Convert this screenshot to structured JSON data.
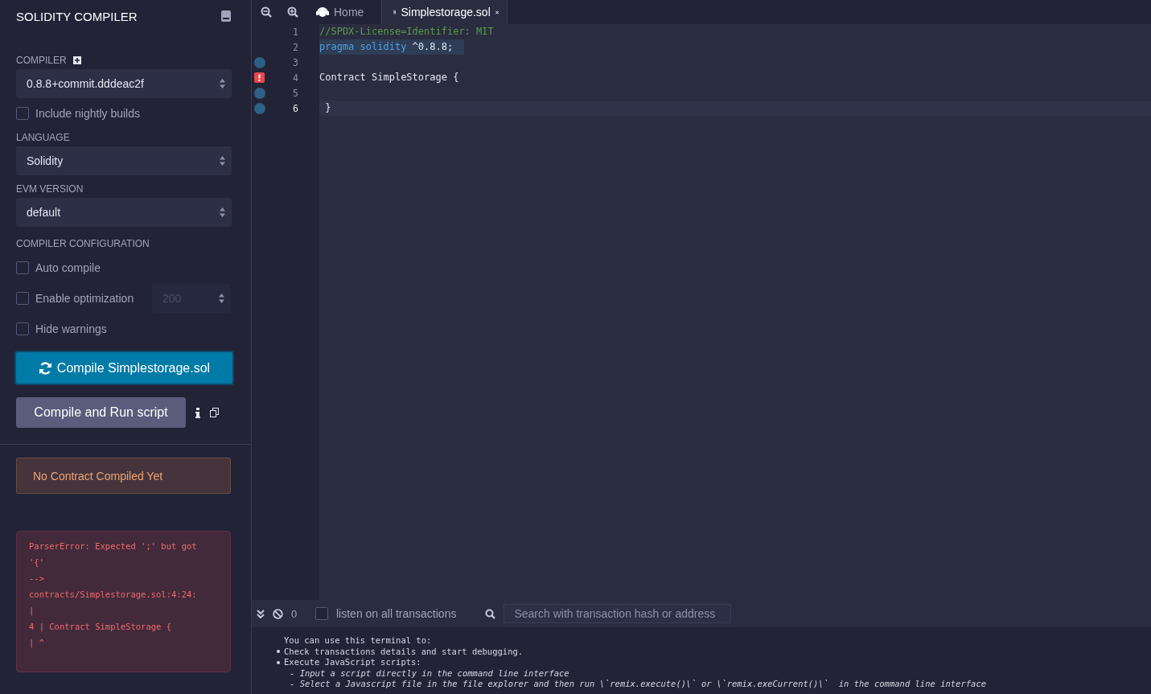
{
  "sidebar": {
    "title": "SOLIDITY COMPILER",
    "compiler": {
      "label": "COMPILER",
      "value": "0.8.8+commit.dddeac2f"
    },
    "nightly": {
      "label": "Include nightly builds",
      "checked": false
    },
    "language": {
      "label": "LANGUAGE",
      "value": "Solidity"
    },
    "evm": {
      "label": "EVM VERSION",
      "value": "default"
    },
    "config": {
      "label": "COMPILER CONFIGURATION"
    },
    "options": [
      {
        "label": "Auto compile",
        "checked": false
      },
      {
        "label": "Enable optimization",
        "checked": false,
        "runs": "200"
      },
      {
        "label": "Hide warnings",
        "checked": false
      }
    ],
    "compile_button": "Compile Simplestorage.sol",
    "run_button": "Compile and Run script",
    "status": "No Contract Compiled Yet",
    "error_lines": [
      "ParserError: Expected ';' but got",
      "'{'",
      "-->",
      "contracts/Simplestorage.sol:4:24:",
      "|",
      "4 | Contract SimpleStorage {",
      "| ^"
    ]
  },
  "tabs": [
    {
      "label": "Home",
      "selected": false,
      "kind": "home"
    },
    {
      "label": "Simplestorage.sol",
      "selected": true,
      "kind": "file"
    }
  ],
  "editor": {
    "lines": [
      {
        "number": "1",
        "kind": "plain",
        "selected": false,
        "current": false,
        "tokens": [
          {
            "text": "//SPDX-License=Identifier: MIT",
            "kind": "comment"
          }
        ]
      },
      {
        "number": "2",
        "kind": "plain",
        "selected": true,
        "current": false,
        "tokens": [
          {
            "text": "pragma solidity",
            "kind": "keyword"
          },
          {
            "text": " ^0.8.8;",
            "kind": "plain"
          }
        ]
      },
      {
        "number": "3",
        "kind": "info",
        "selected": false,
        "current": false
      },
      {
        "number": "4",
        "kind": "error",
        "selected": false,
        "current": false,
        "tokens": [
          {
            "text": "Contract SimpleStorage {",
            "kind": "plain"
          }
        ]
      },
      {
        "number": "5",
        "kind": "info",
        "selected": false,
        "current": false
      },
      {
        "number": "6",
        "kind": "info",
        "selected": false,
        "current": true,
        "tokens": [
          {
            "text": " }",
            "kind": "plain"
          }
        ]
      }
    ]
  },
  "terminal": {
    "count": "0",
    "listen": {
      "label": "listen on all transactions",
      "checked": false
    },
    "search": {
      "placeholder": "Search with transaction hash or address"
    },
    "intro": "You can use this terminal to:",
    "items": [
      {
        "text": "Check transactions details and start debugging."
      },
      {
        "text": "Execute JavaScript scripts:",
        "children": [
          "- Input a script directly in the command line interface",
          "- Select a Javascript file in the file explorer and then run \\`remix.execute()\\` or \\`remix.exeCurrent()\\`  in the command line interface"
        ]
      }
    ]
  }
}
